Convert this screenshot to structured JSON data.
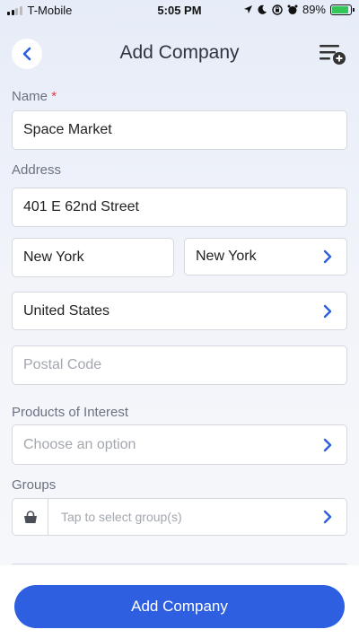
{
  "status_bar": {
    "carrier": "T-Mobile",
    "time": "5:05 PM",
    "battery_percent": "89%",
    "battery_level": 0.89,
    "icons": [
      "location-arrow-icon",
      "moon-icon",
      "screen-lock-icon",
      "alarm-icon",
      "battery-charging-icon"
    ]
  },
  "header": {
    "title": "Add Company",
    "back_icon": "chevron-left-icon",
    "menu_icon": "list-add-icon"
  },
  "form": {
    "name": {
      "label": "Name",
      "required_mark": "*",
      "value": "Space Market"
    },
    "address": {
      "label": "Address",
      "street": "401 E 62nd Street",
      "city": "New York",
      "state": "New York",
      "country": "United States",
      "postal_placeholder": "Postal Code"
    },
    "products": {
      "label": "Products of Interest",
      "placeholder": "Choose an option"
    },
    "groups": {
      "label": "Groups",
      "placeholder": "Tap to select group(s)",
      "icon": "basket-icon"
    }
  },
  "footer": {
    "submit_label": "Add Company"
  },
  "colors": {
    "accent": "#2d5fe0",
    "required": "#d9414a",
    "battery": "#33c659"
  }
}
